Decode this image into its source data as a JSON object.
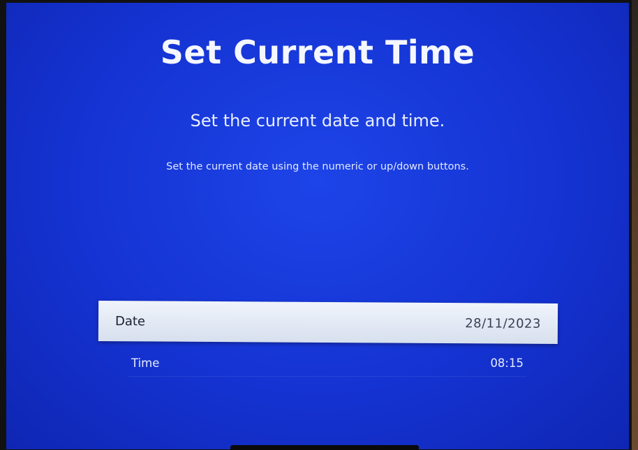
{
  "dialog": {
    "title": "Set Current Time",
    "subtitle": "Set the current date and time.",
    "instruction": "Set the current date using the numeric or up/down buttons."
  },
  "settings": [
    {
      "label": "Date",
      "value": "28/11/2023",
      "focused": true
    },
    {
      "label": "Time",
      "value": "08:15",
      "focused": false
    }
  ],
  "colors": {
    "screen_background": "#1533d2",
    "focused_row": "#e6ecf6",
    "text": "#eef2ff"
  }
}
